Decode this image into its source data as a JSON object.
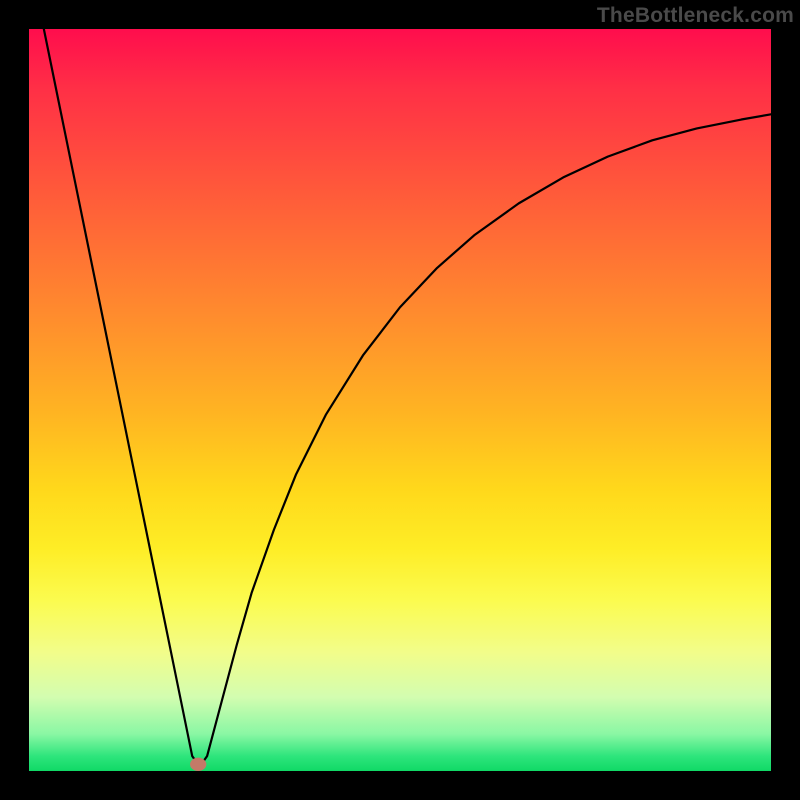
{
  "watermark": {
    "text": "TheBottleneck.com"
  },
  "chart_data": {
    "type": "line",
    "note": "Axes are unlabeled and have no ticks; x and y values are in the 0–100 domain (percent of plot-area width/height, origin bottom-left). Values estimated from gridless chart.",
    "xlim": [
      0,
      100
    ],
    "ylim": [
      0,
      100
    ],
    "title": "",
    "xlabel": "",
    "ylabel": "",
    "series": [
      {
        "name": "curve",
        "color": "#000000",
        "stroke_width": 2.2,
        "x": [
          2,
          4,
          6,
          8,
          10,
          12,
          14,
          16,
          18,
          20,
          21,
          22,
          23,
          24,
          26,
          28,
          30,
          33,
          36,
          40,
          45,
          50,
          55,
          60,
          66,
          72,
          78,
          84,
          90,
          96,
          100
        ],
        "y": [
          100,
          90.2,
          80.4,
          70.6,
          60.8,
          51.0,
          41.2,
          31.4,
          21.6,
          11.8,
          6.9,
          2.0,
          0.6,
          2.0,
          9.5,
          17.0,
          24.0,
          32.5,
          40.0,
          48.0,
          56.0,
          62.5,
          67.8,
          72.2,
          76.5,
          80.0,
          82.8,
          85.0,
          86.6,
          87.8,
          88.5
        ]
      }
    ],
    "markers": [
      {
        "name": "min-point",
        "shape": "ellipse",
        "cx": 22.8,
        "cy": 0.9,
        "rx": 1.1,
        "ry": 0.9,
        "fill": "#c47a68"
      }
    ],
    "gradient_colors": {
      "top": "#ff0d4d",
      "mid_upper": "#ff8a2e",
      "mid": "#ffd81b",
      "mid_lower": "#fbfb4f",
      "bottom": "#10d966"
    }
  }
}
